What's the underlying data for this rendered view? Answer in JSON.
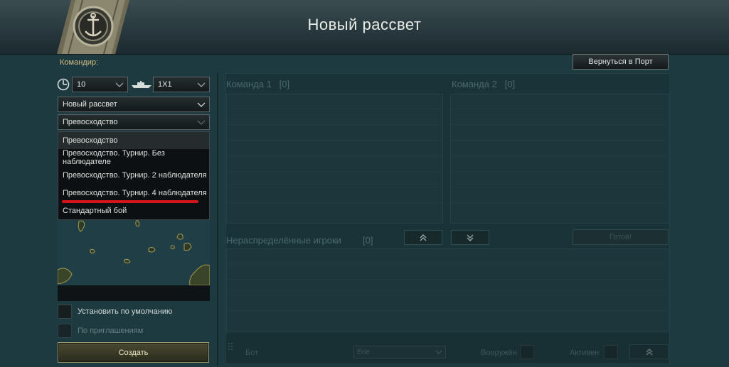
{
  "header": {
    "title": "Новый рассвет"
  },
  "commander_label": "Командир:",
  "back_button": "Вернуться в Порт",
  "filters": {
    "tier_value": "10",
    "format_value": "1Х1"
  },
  "scenario_select": "Новый рассвет",
  "mode_select": "Превосходство",
  "mode_options": [
    "Превосходство",
    "Превосходство. Турнир. Без наблюдателе",
    "Превосходство. Турнир. 2 наблюдателя",
    "Превосходство. Турнир. 4 наблюдателя",
    "Стандартный бой"
  ],
  "highlighted_option_index": 3,
  "checkboxes": {
    "default": "Установить по умолчанию",
    "invites": "По приглашениям"
  },
  "create_button": "Создать",
  "teams": {
    "team1": {
      "label": "Команда 1",
      "count": "[0]"
    },
    "team2": {
      "label": "Команда 2",
      "count": "[0]"
    }
  },
  "unassigned": {
    "label": "Нераспределённые игроки",
    "count": "[0]"
  },
  "ready_button": "Готов!",
  "footer": {
    "bot_label": "Бот",
    "select_value": "Erie",
    "armed_label": "Вооружён",
    "active_label": "Активен"
  },
  "colors": {
    "accent": "#d2bd86",
    "highlight": "#d4151c",
    "background": "#1d3a40"
  }
}
